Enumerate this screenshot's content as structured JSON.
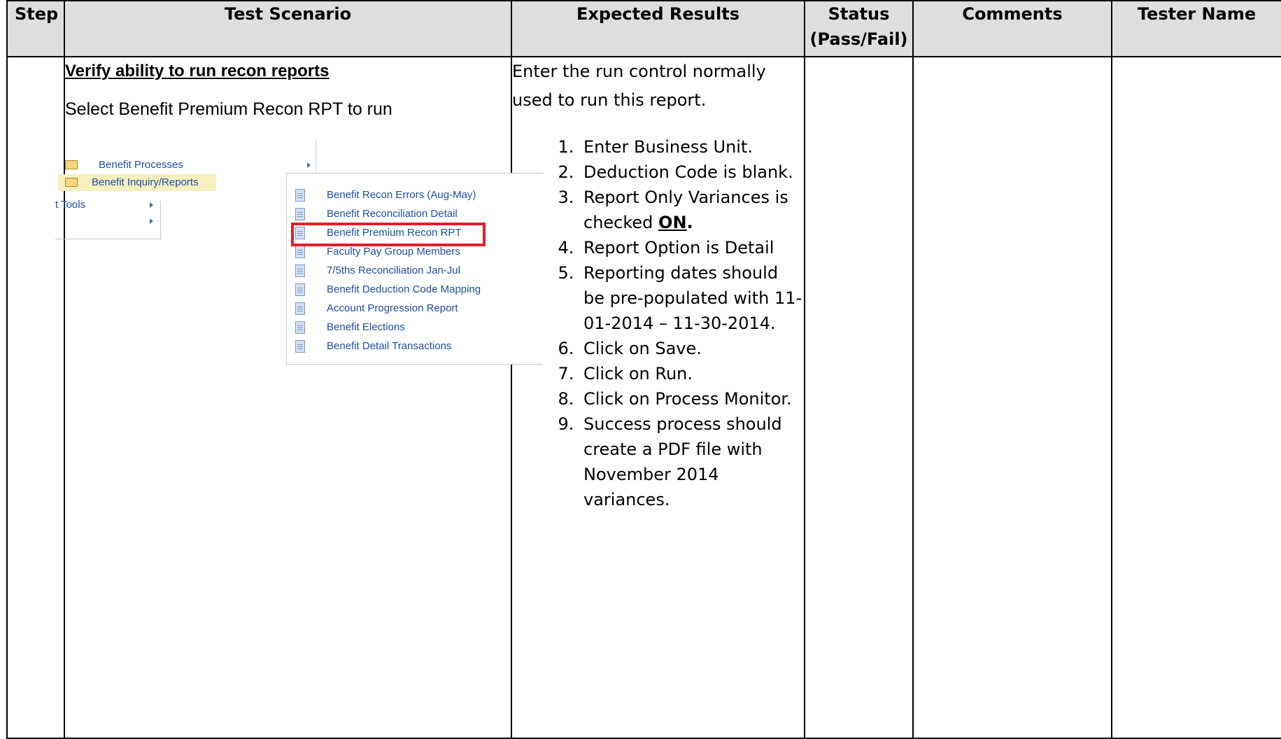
{
  "headers": {
    "step": "Step",
    "scenario": "Test Scenario",
    "expected": "Expected Results",
    "status_line1": "Status",
    "status_line2": "(Pass/Fail)",
    "comments": "Comments",
    "tester": "Tester Name"
  },
  "scenario": {
    "title": "Verify ability to run recon reports",
    "instruction": "Select Benefit Premium Recon RPT to run",
    "menu": {
      "level1": [
        {
          "label": "Benefit Processes",
          "icon": "folder-icon"
        },
        {
          "label": "Benefit Inquiry/Reports",
          "icon": "folder-icon",
          "highlighted": true
        },
        {
          "label": "t Tools"
        }
      ],
      "submenu": [
        "Benefit Recon Errors (Aug-May)",
        "Benefit Reconciliation Detail",
        "Benefit Premium Recon RPT",
        "Faculty Pay Group Members",
        "7/5ths Reconciliation Jan-Jul",
        "Benefit Deduction Code Mapping",
        "Account Progression Report",
        "Benefit Elections",
        "Benefit Detail Transactions"
      ],
      "selected_item": "Benefit Premium Recon RPT",
      "highlight_color": "#e0202a",
      "link_color": "#1f4ea3"
    }
  },
  "expected": {
    "intro": "Enter the run control normally used to run this report.",
    "steps": [
      "Enter Business Unit.",
      "Deduction Code is blank.",
      "Report Only Variances is checked ",
      "Report Option is Detail",
      "Reporting dates should be pre-populated with 11-01-2014 – 11-30-2014.",
      "Click on Save.",
      "Click on Run.",
      "Click on Process Monitor.",
      "Success process should create a PDF file with November 2014 variances."
    ],
    "step3_emphasis": "ON",
    "step3_suffix": "."
  },
  "row": {
    "step": "",
    "status": "",
    "comments": "",
    "tester": ""
  },
  "colors": {
    "header_bg": "#dedede",
    "border": "#000000"
  }
}
